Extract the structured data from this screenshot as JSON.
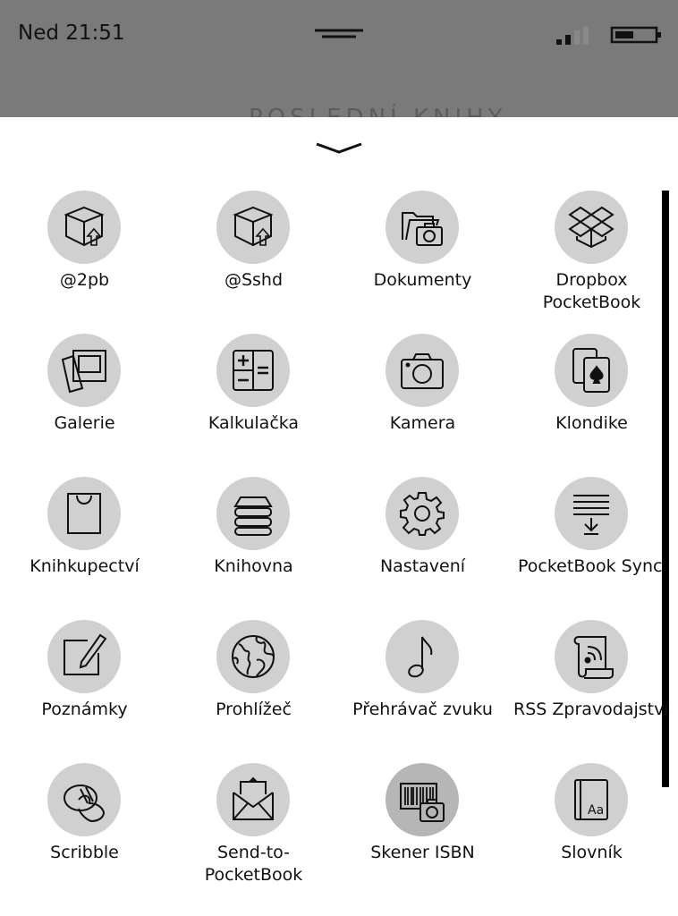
{
  "status": {
    "time": "Ned 21:51",
    "peek_title": "POSLEDNÍ KNIHY"
  },
  "apps": [
    {
      "label": "@2pb",
      "icon": "upload-box-icon"
    },
    {
      "label": "@Sshd",
      "icon": "upload-box-icon"
    },
    {
      "label": "Dokumenty",
      "icon": "folder-camera-icon"
    },
    {
      "label": "Dropbox PocketBook",
      "icon": "dropbox-icon"
    },
    {
      "label": "Galerie",
      "icon": "photos-icon"
    },
    {
      "label": "Kalkulačka",
      "icon": "calculator-icon"
    },
    {
      "label": "Kamera",
      "icon": "camera-icon"
    },
    {
      "label": "Klondike",
      "icon": "cards-icon"
    },
    {
      "label": "Knihkupectví",
      "icon": "shopping-bag-icon"
    },
    {
      "label": "Knihovna",
      "icon": "books-stack-icon"
    },
    {
      "label": "Nastavení",
      "icon": "gear-icon"
    },
    {
      "label": "PocketBook Sync",
      "icon": "sync-download-icon"
    },
    {
      "label": "Poznámky",
      "icon": "note-pencil-icon"
    },
    {
      "label": "Prohlížeč",
      "icon": "globe-icon"
    },
    {
      "label": "Přehrávač zvuku",
      "icon": "music-note-icon"
    },
    {
      "label": "RSS Zpravodajství",
      "icon": "rss-scroll-icon"
    },
    {
      "label": "Scribble",
      "icon": "scribble-hand-icon"
    },
    {
      "label": "Send-to-PocketBook",
      "icon": "envelope-icon"
    },
    {
      "label": "Skener ISBN",
      "icon": "barcode-camera-icon"
    },
    {
      "label": "Slovník",
      "icon": "dictionary-icon"
    }
  ]
}
